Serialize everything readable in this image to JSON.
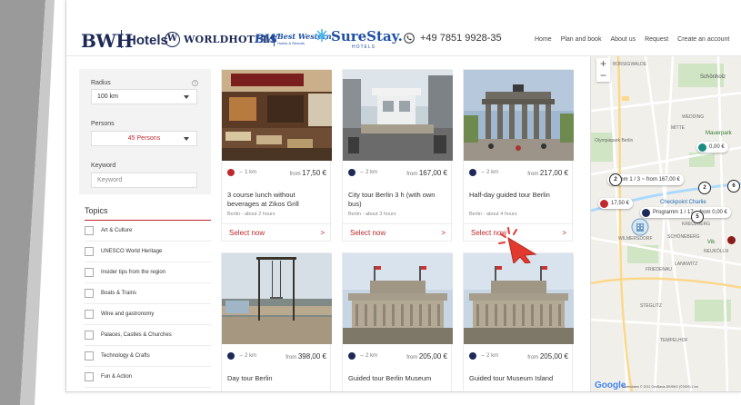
{
  "header": {
    "brand": "BWH",
    "brand_sub": "Hotels",
    "wh_mark": "W",
    "wh_text": "WORLDHOTELS",
    "bw_short": "BW",
    "bw_full_line1": "Best Western.",
    "bw_full_line2": "Hotels & Resorts",
    "surestay": "SureStay.",
    "surestay_sub": "HOTELS",
    "phone": "+49 7851 9928-35",
    "nav": [
      "Home",
      "Plan and book",
      "About us",
      "Request",
      "Create an account"
    ]
  },
  "filters": {
    "radius_label": "Radius",
    "radius_value": "100 km",
    "persons_label": "Persons",
    "persons_value": "45 Persons",
    "keyword_label": "Keyword",
    "keyword_placeholder": "Keyword"
  },
  "topics": {
    "heading": "Topics",
    "items": [
      "Art & Culture",
      "UNESCO World Heritage",
      "Insider tips from the region",
      "Boats & Trains",
      "Wine and gastronomy",
      "Palaces, Castles & Churches",
      "Technology & Crafts",
      "Fun & Action"
    ]
  },
  "cards": [
    {
      "distance": "1 km",
      "from": "from",
      "price": "17,50 €",
      "title": "3 course lunch without beverages at Zikos Grill",
      "sub": "Berlin - about 2 hours",
      "button": "Select now",
      "dot_color": "#c0282d"
    },
    {
      "distance": "2 km",
      "from": "from",
      "price": "167,00 €",
      "title": "City tour Berlin 3 h (with own bus)",
      "sub": "Berlin - about 3 hours",
      "button": "Select now",
      "dot_color": "#1d2a57"
    },
    {
      "distance": "2 km",
      "from": "from",
      "price": "217,00 €",
      "title": "Half-day guided tour Berlin",
      "sub": "Berlin - about 4 hours",
      "button": "Select now",
      "dot_color": "#1d2a57"
    },
    {
      "distance": "2 km",
      "from": "from",
      "price": "398,00 €",
      "title": "Day tour Berlin",
      "sub": "",
      "button": "",
      "dot_color": "#1d2a57"
    },
    {
      "distance": "2 km",
      "from": "from",
      "price": "205,00 €",
      "title": "Guided tour Berlin Museum",
      "sub": "",
      "button": "",
      "dot_color": "#1d2a57"
    },
    {
      "distance": "2 km",
      "from": "from",
      "price": "205,00 €",
      "title": "Guided tour Museum Island",
      "sub": "",
      "button": "",
      "dot_color": "#1d2a57"
    }
  ],
  "map": {
    "places": [
      "Schönholz",
      "Mauerpark",
      "Checkpoint Charlie",
      "SCHÖNEBERG",
      "WILMERSDORF",
      "NEUKÖLLN",
      "Vik",
      "TEMPELHOF",
      "LANKWITZ",
      "STEGLITZ",
      "FRIEDENAU",
      "MITTE",
      "WEDDING",
      "KREUZBERG",
      "Olympiapark Berlin"
    ],
    "pill_top_left": "2",
    "pill_prog1": "gramm 1 / 3 ~ from 167,00 €",
    "pill_price_red": "17,50 €",
    "pill_prog2": "Programm 1 / 17 ~ from 0,00 €",
    "pill_teal": "0,00 €",
    "cluster_a": "2",
    "cluster_b": "6",
    "cluster_c": "5",
    "google": "Google",
    "attribution": "Kartendaten © 2021 GeoBasis-DE/BKG (©2009)  1 km",
    "zoom_plus": "+",
    "zoom_minus": "−",
    "teal": "#1a8c82",
    "accent": "#c0282d",
    "navy": "#1d2a57"
  }
}
